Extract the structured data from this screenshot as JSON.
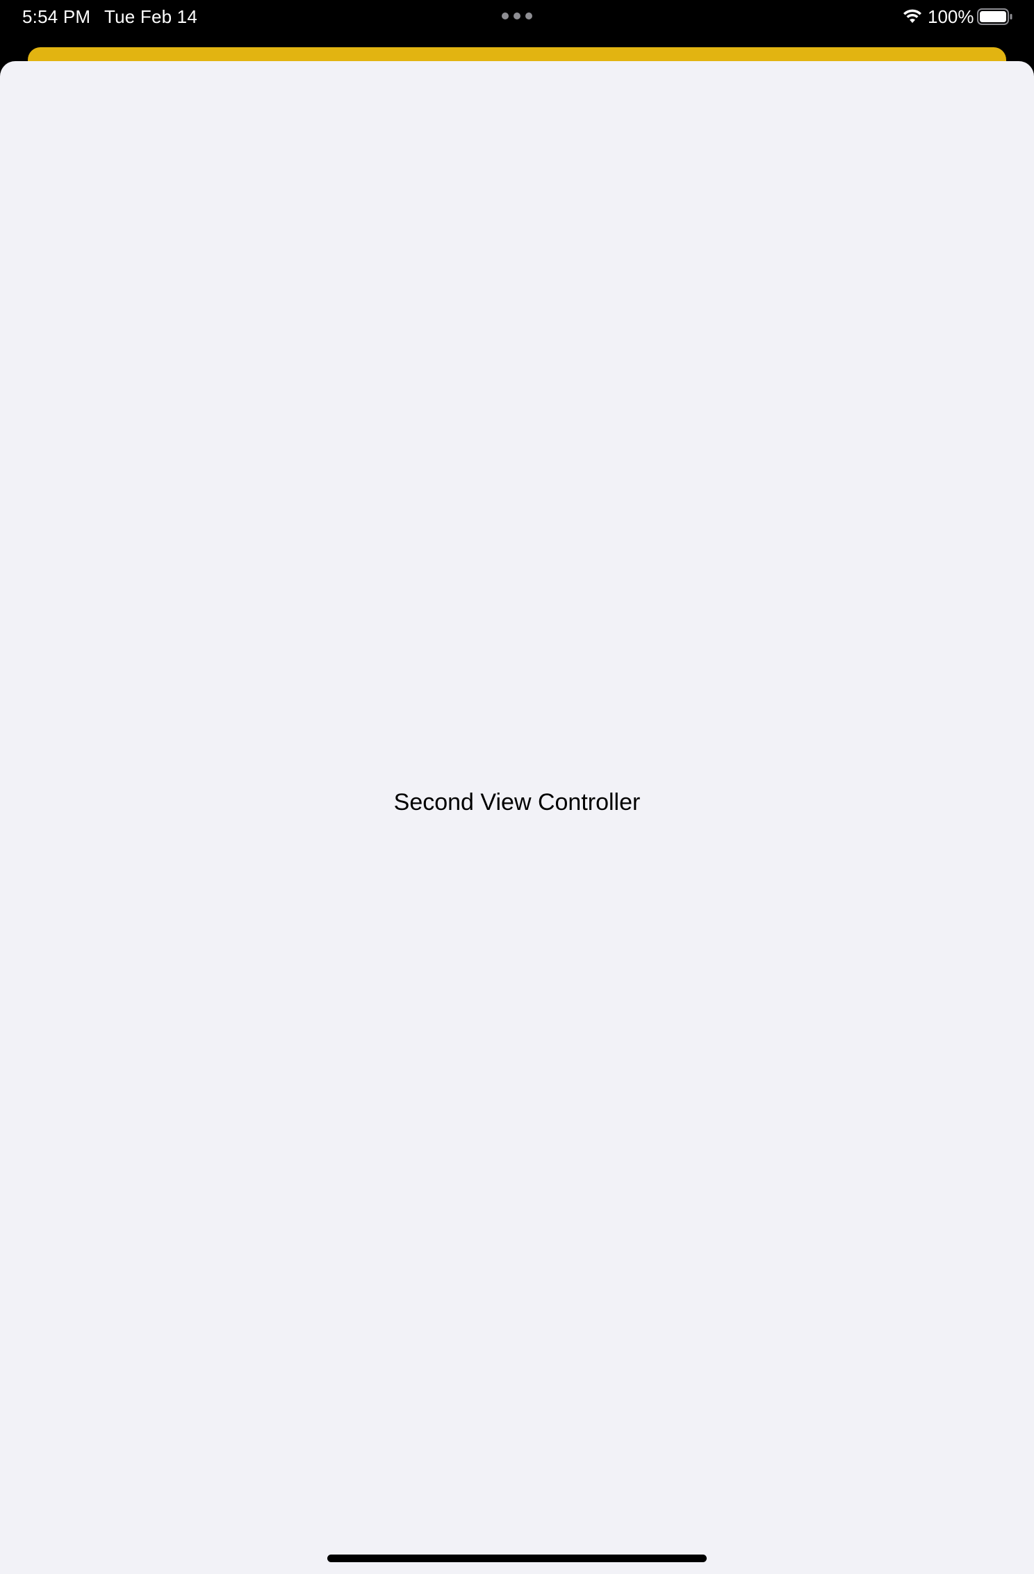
{
  "status_bar": {
    "time": "5:54 PM",
    "date": "Tue Feb 14",
    "battery_percent": "100%",
    "battery_level": 1.0,
    "wifi_icon": "wifi-icon",
    "battery_icon": "battery-icon",
    "multitask_icon": "multitask-dots-icon"
  },
  "colors": {
    "status_bar_background": "#000000",
    "back_card": "#e2b411",
    "sheet_background": "#f2f2f7",
    "text": "#000000"
  },
  "main": {
    "label": "Second View Controller"
  }
}
